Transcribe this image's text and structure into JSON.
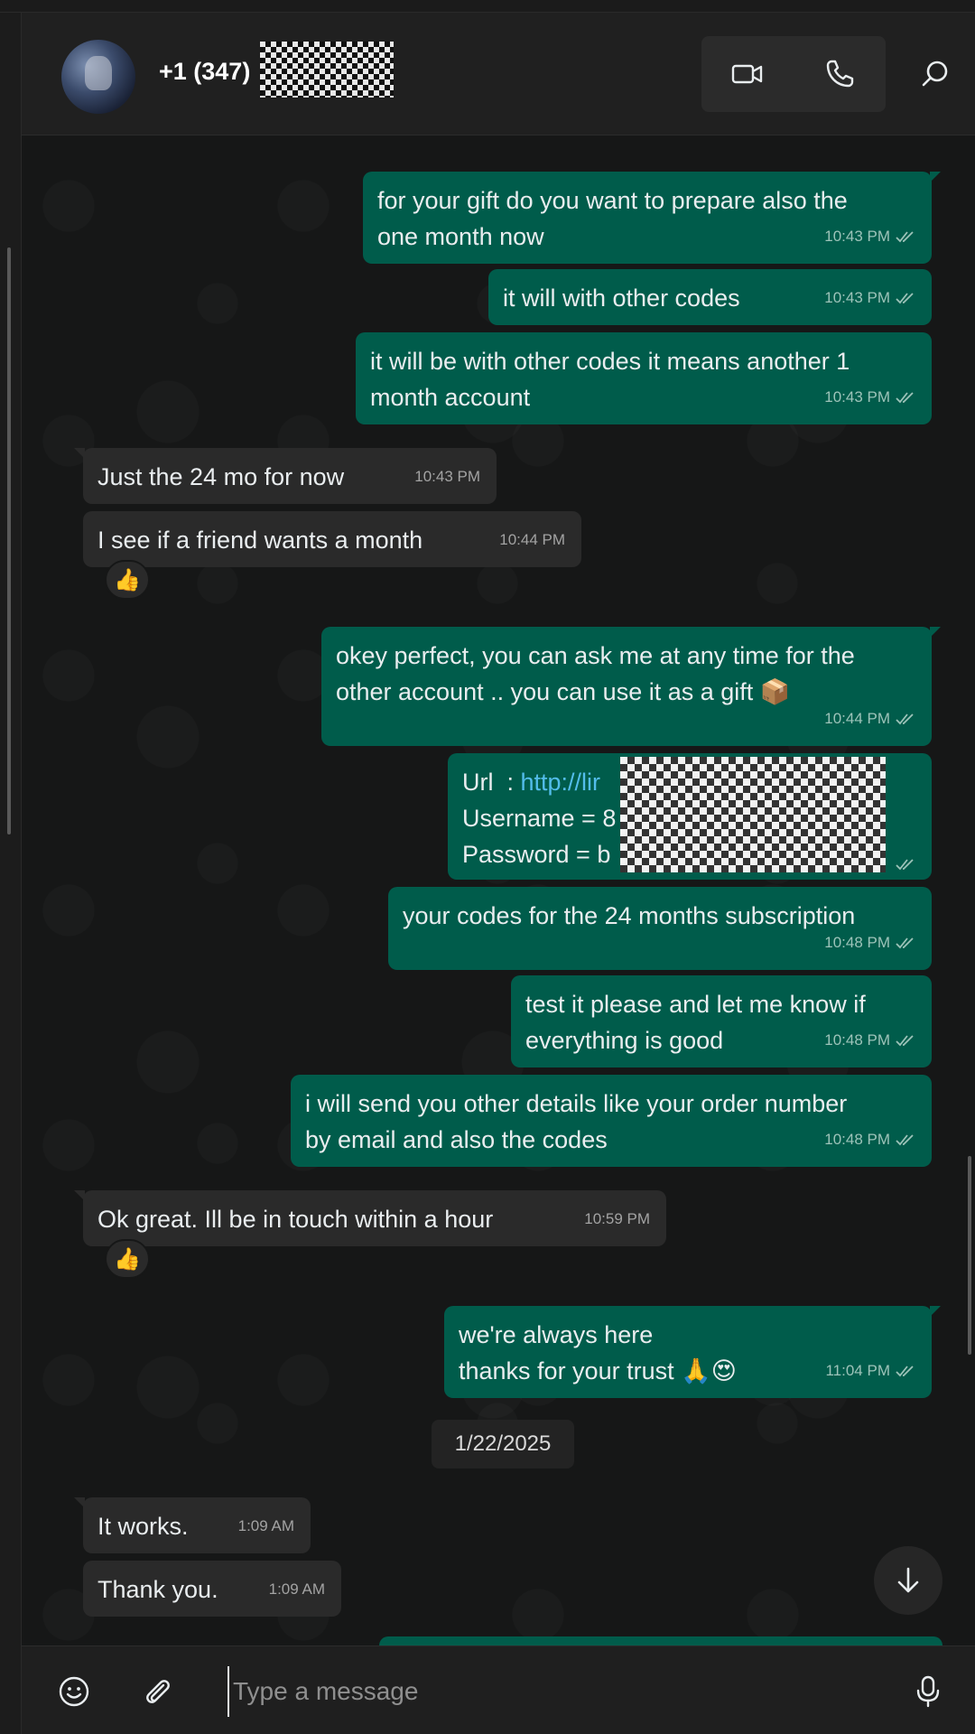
{
  "header": {
    "contact_name": "+1 (347)"
  },
  "messages": [
    {
      "dir": "out",
      "text": "for your gift do you want to prepare also the\none month now",
      "time": "10:43 PM"
    },
    {
      "dir": "out",
      "text": "it will with other codes",
      "time": "10:43 PM"
    },
    {
      "dir": "out",
      "text": "it will be with other codes it means another 1\nmonth account",
      "time": "10:43 PM"
    },
    {
      "dir": "in",
      "text": "Just the 24 mo for now",
      "time": "10:43 PM"
    },
    {
      "dir": "in",
      "text": "I see if a friend wants a month",
      "time": "10:44 PM",
      "reaction": "👍"
    },
    {
      "dir": "out",
      "text": "okey perfect, you can ask me at any time for the\nother account .. you can use it as a gift 📦",
      "time": "10:44 PM"
    },
    {
      "dir": "out",
      "credentials": {
        "url_label": "Url  : ",
        "url_value": "http://lir",
        "username_label": "Username = 8",
        "password_label": "Password = b"
      }
    },
    {
      "dir": "out",
      "text": "your codes for the 24 months subscription",
      "time": "10:48 PM"
    },
    {
      "dir": "out",
      "text": "test it please and let me know if\neverything is good",
      "time": "10:48 PM"
    },
    {
      "dir": "out",
      "text": "i will send you other details like your order number\nby email and also the codes",
      "time": "10:48 PM"
    },
    {
      "dir": "in",
      "text": "Ok great. Ill be in touch within a hour",
      "time": "10:59 PM",
      "reaction": "👍"
    },
    {
      "dir": "out",
      "text": "we're always here\nthanks for your trust 🙏😍",
      "time": "11:04 PM"
    },
    {
      "dir": "in",
      "text": "It works.",
      "time": "1:09 AM"
    },
    {
      "dir": "in",
      "text": "Thank you.",
      "time": "1:09 AM"
    }
  ],
  "date_separator": "1/22/2025",
  "composer": {
    "placeholder": "Type a message"
  },
  "icons": {
    "video": "video-call-icon",
    "voice": "voice-call-icon",
    "search": "search-icon",
    "emoji": "emoji-icon",
    "attach": "attach-icon",
    "mic": "mic-icon",
    "scroll": "arrow-down-icon",
    "read": "double-check-icon"
  },
  "colors": {
    "outgoing_bubble": "#005c4b",
    "incoming_bubble": "#2a2a2a",
    "chat_background": "#161717",
    "link": "#53bdeb"
  }
}
